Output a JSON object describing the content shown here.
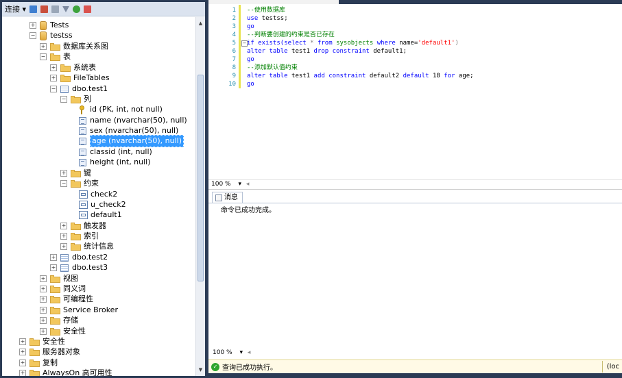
{
  "object_explorer": {
    "toolbar": {
      "connect_label": "连接 ▾"
    },
    "nodes": [
      {
        "label": "Tests",
        "icon": "database-icon",
        "expander": "+"
      },
      {
        "label": "testss",
        "icon": "database-icon",
        "expander": "−"
      },
      {
        "label": "数据库关系图",
        "icon": "folder-icon",
        "expander": "+"
      },
      {
        "label": "表",
        "icon": "folder-icon",
        "expander": "−"
      },
      {
        "label": "系统表",
        "icon": "folder-icon",
        "expander": "+"
      },
      {
        "label": "FileTables",
        "icon": "folder-icon",
        "expander": "+"
      },
      {
        "label": "dbo.test1",
        "icon": "table-icon",
        "expander": "−"
      },
      {
        "label": "列",
        "icon": "folder-icon",
        "expander": "−"
      },
      {
        "label": "id (PK, int, not null)",
        "icon": "primary-key-icon",
        "expander": ""
      },
      {
        "label": "name (nvarchar(50), null)",
        "icon": "column-icon",
        "expander": ""
      },
      {
        "label": "sex (nvarchar(50), null)",
        "icon": "column-icon",
        "expander": ""
      },
      {
        "label": "age (nvarchar(50), null)",
        "icon": "column-icon",
        "expander": "",
        "selected": true
      },
      {
        "label": "classid (int, null)",
        "icon": "column-icon",
        "expander": ""
      },
      {
        "label": "height (int, null)",
        "icon": "column-icon",
        "expander": ""
      },
      {
        "label": "键",
        "icon": "folder-icon",
        "expander": "+"
      },
      {
        "label": "约束",
        "icon": "folder-icon",
        "expander": "−"
      },
      {
        "label": "check2",
        "icon": "constraint-icon",
        "expander": ""
      },
      {
        "label": "u_check2",
        "icon": "constraint-icon",
        "expander": ""
      },
      {
        "label": "default1",
        "icon": "default-constraint-icon",
        "expander": ""
      },
      {
        "label": "触发器",
        "icon": "folder-icon",
        "expander": "+"
      },
      {
        "label": "索引",
        "icon": "folder-icon",
        "expander": "+"
      },
      {
        "label": "统计信息",
        "icon": "folder-icon",
        "expander": "+"
      },
      {
        "label": "dbo.test2",
        "icon": "table-icon",
        "expander": "+"
      },
      {
        "label": "dbo.test3",
        "icon": "table-icon",
        "expander": "+"
      },
      {
        "label": "视图",
        "icon": "folder-icon",
        "expander": "+"
      },
      {
        "label": "同义词",
        "icon": "folder-icon",
        "expander": "+"
      },
      {
        "label": "可编程性",
        "icon": "folder-icon",
        "expander": "+"
      },
      {
        "label": "Service Broker",
        "icon": "folder-icon",
        "expander": "+"
      },
      {
        "label": "存储",
        "icon": "folder-icon",
        "expander": "+"
      },
      {
        "label": "安全性",
        "icon": "folder-icon",
        "expander": "+"
      },
      {
        "label": "安全性",
        "icon": "folder-icon",
        "expander": "+"
      },
      {
        "label": "服务器对象",
        "icon": "folder-icon",
        "expander": "+"
      },
      {
        "label": "复制",
        "icon": "folder-icon",
        "expander": "+"
      },
      {
        "label": "AlwaysOn 高可用性",
        "icon": "folder-icon",
        "expander": "+"
      }
    ]
  },
  "editor": {
    "line_numbers": [
      "1",
      "2",
      "3",
      "4",
      "5",
      "6",
      "7",
      "8",
      "9",
      "10"
    ],
    "lines": {
      "l1": "--使用数据库",
      "l2_kw": "use",
      "l2_rest": " testss;",
      "l3": "go",
      "l4": "--判断要创建的约束是否已存在",
      "l5_a": "if exists(",
      "l5_b": "select",
      "l5_c": " * ",
      "l5_d": "from",
      "l5_e": " ",
      "l5_f": "sysobjects",
      "l5_g": " ",
      "l5_h": "where",
      "l5_i": " name=",
      "l5_j": "'default1'",
      "l5_k": ")",
      "l6_a": "alter table",
      "l6_b": " test1 ",
      "l6_c": "drop constraint",
      "l6_d": " default1;",
      "l7": "go",
      "l8": "--添加默认值约束",
      "l9_a": "alter table",
      "l9_b": " test1 ",
      "l9_c": "add constraint",
      "l9_d": " default2 ",
      "l9_e": "default",
      "l9_f": " 18 ",
      "l9_g": "for",
      "l9_h": " age;",
      "l10": "go"
    },
    "zoom": "100 %"
  },
  "results": {
    "tab_label": "消息",
    "message": "命令已成功完成。",
    "zoom": "100 %"
  },
  "status": {
    "text": "查询已成功执行。",
    "server": "(loc"
  }
}
